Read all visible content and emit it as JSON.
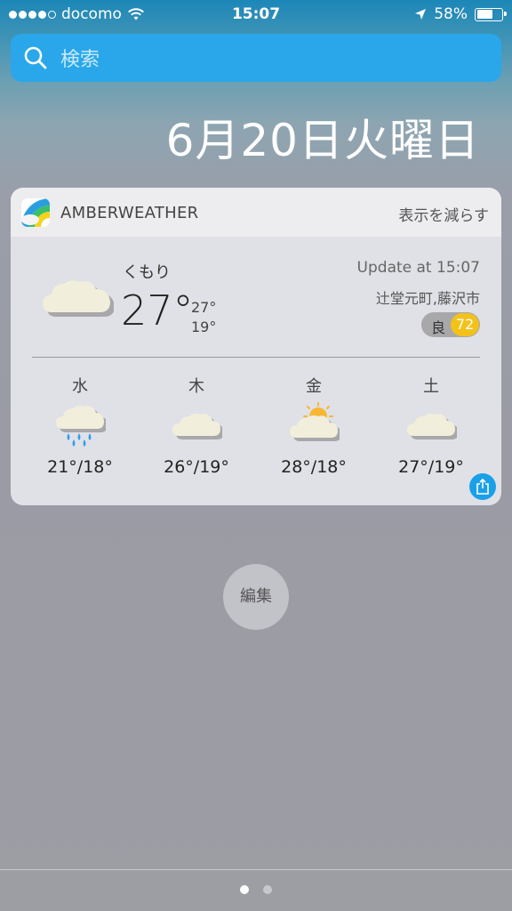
{
  "status_bar": {
    "carrier": "docomo",
    "time": "15:07",
    "battery": "58%",
    "signal_bars": 4
  },
  "search": {
    "placeholder": "検索"
  },
  "date_header": "6月20日火曜日",
  "widget": {
    "app_name": "AMBERWEATHER",
    "show_less": "表示を減らす",
    "current": {
      "condition": "くもり",
      "temp": "27°",
      "high": "27°",
      "low": "19°",
      "icon": "cloud-icon"
    },
    "update": "Update at 15:07",
    "location": "辻堂元町,藤沢市",
    "aqi": {
      "label": "良",
      "value": "72",
      "color": "#f3c21a"
    },
    "forecast": [
      {
        "day": "水",
        "temps": "21°/18°",
        "icon": "rain-cloud-icon"
      },
      {
        "day": "木",
        "temps": "26°/19°",
        "icon": "cloud-icon"
      },
      {
        "day": "金",
        "temps": "28°/18°",
        "icon": "partly-sunny-icon"
      },
      {
        "day": "土",
        "temps": "27°/19°",
        "icon": "cloud-icon"
      }
    ]
  },
  "edit_button": "編集",
  "colors": {
    "search_bar": "#2aa7ea",
    "share_button": "#1aa0e8",
    "aqi_badge": "#f3c21a"
  },
  "pages": {
    "count": 2,
    "active": 1
  }
}
